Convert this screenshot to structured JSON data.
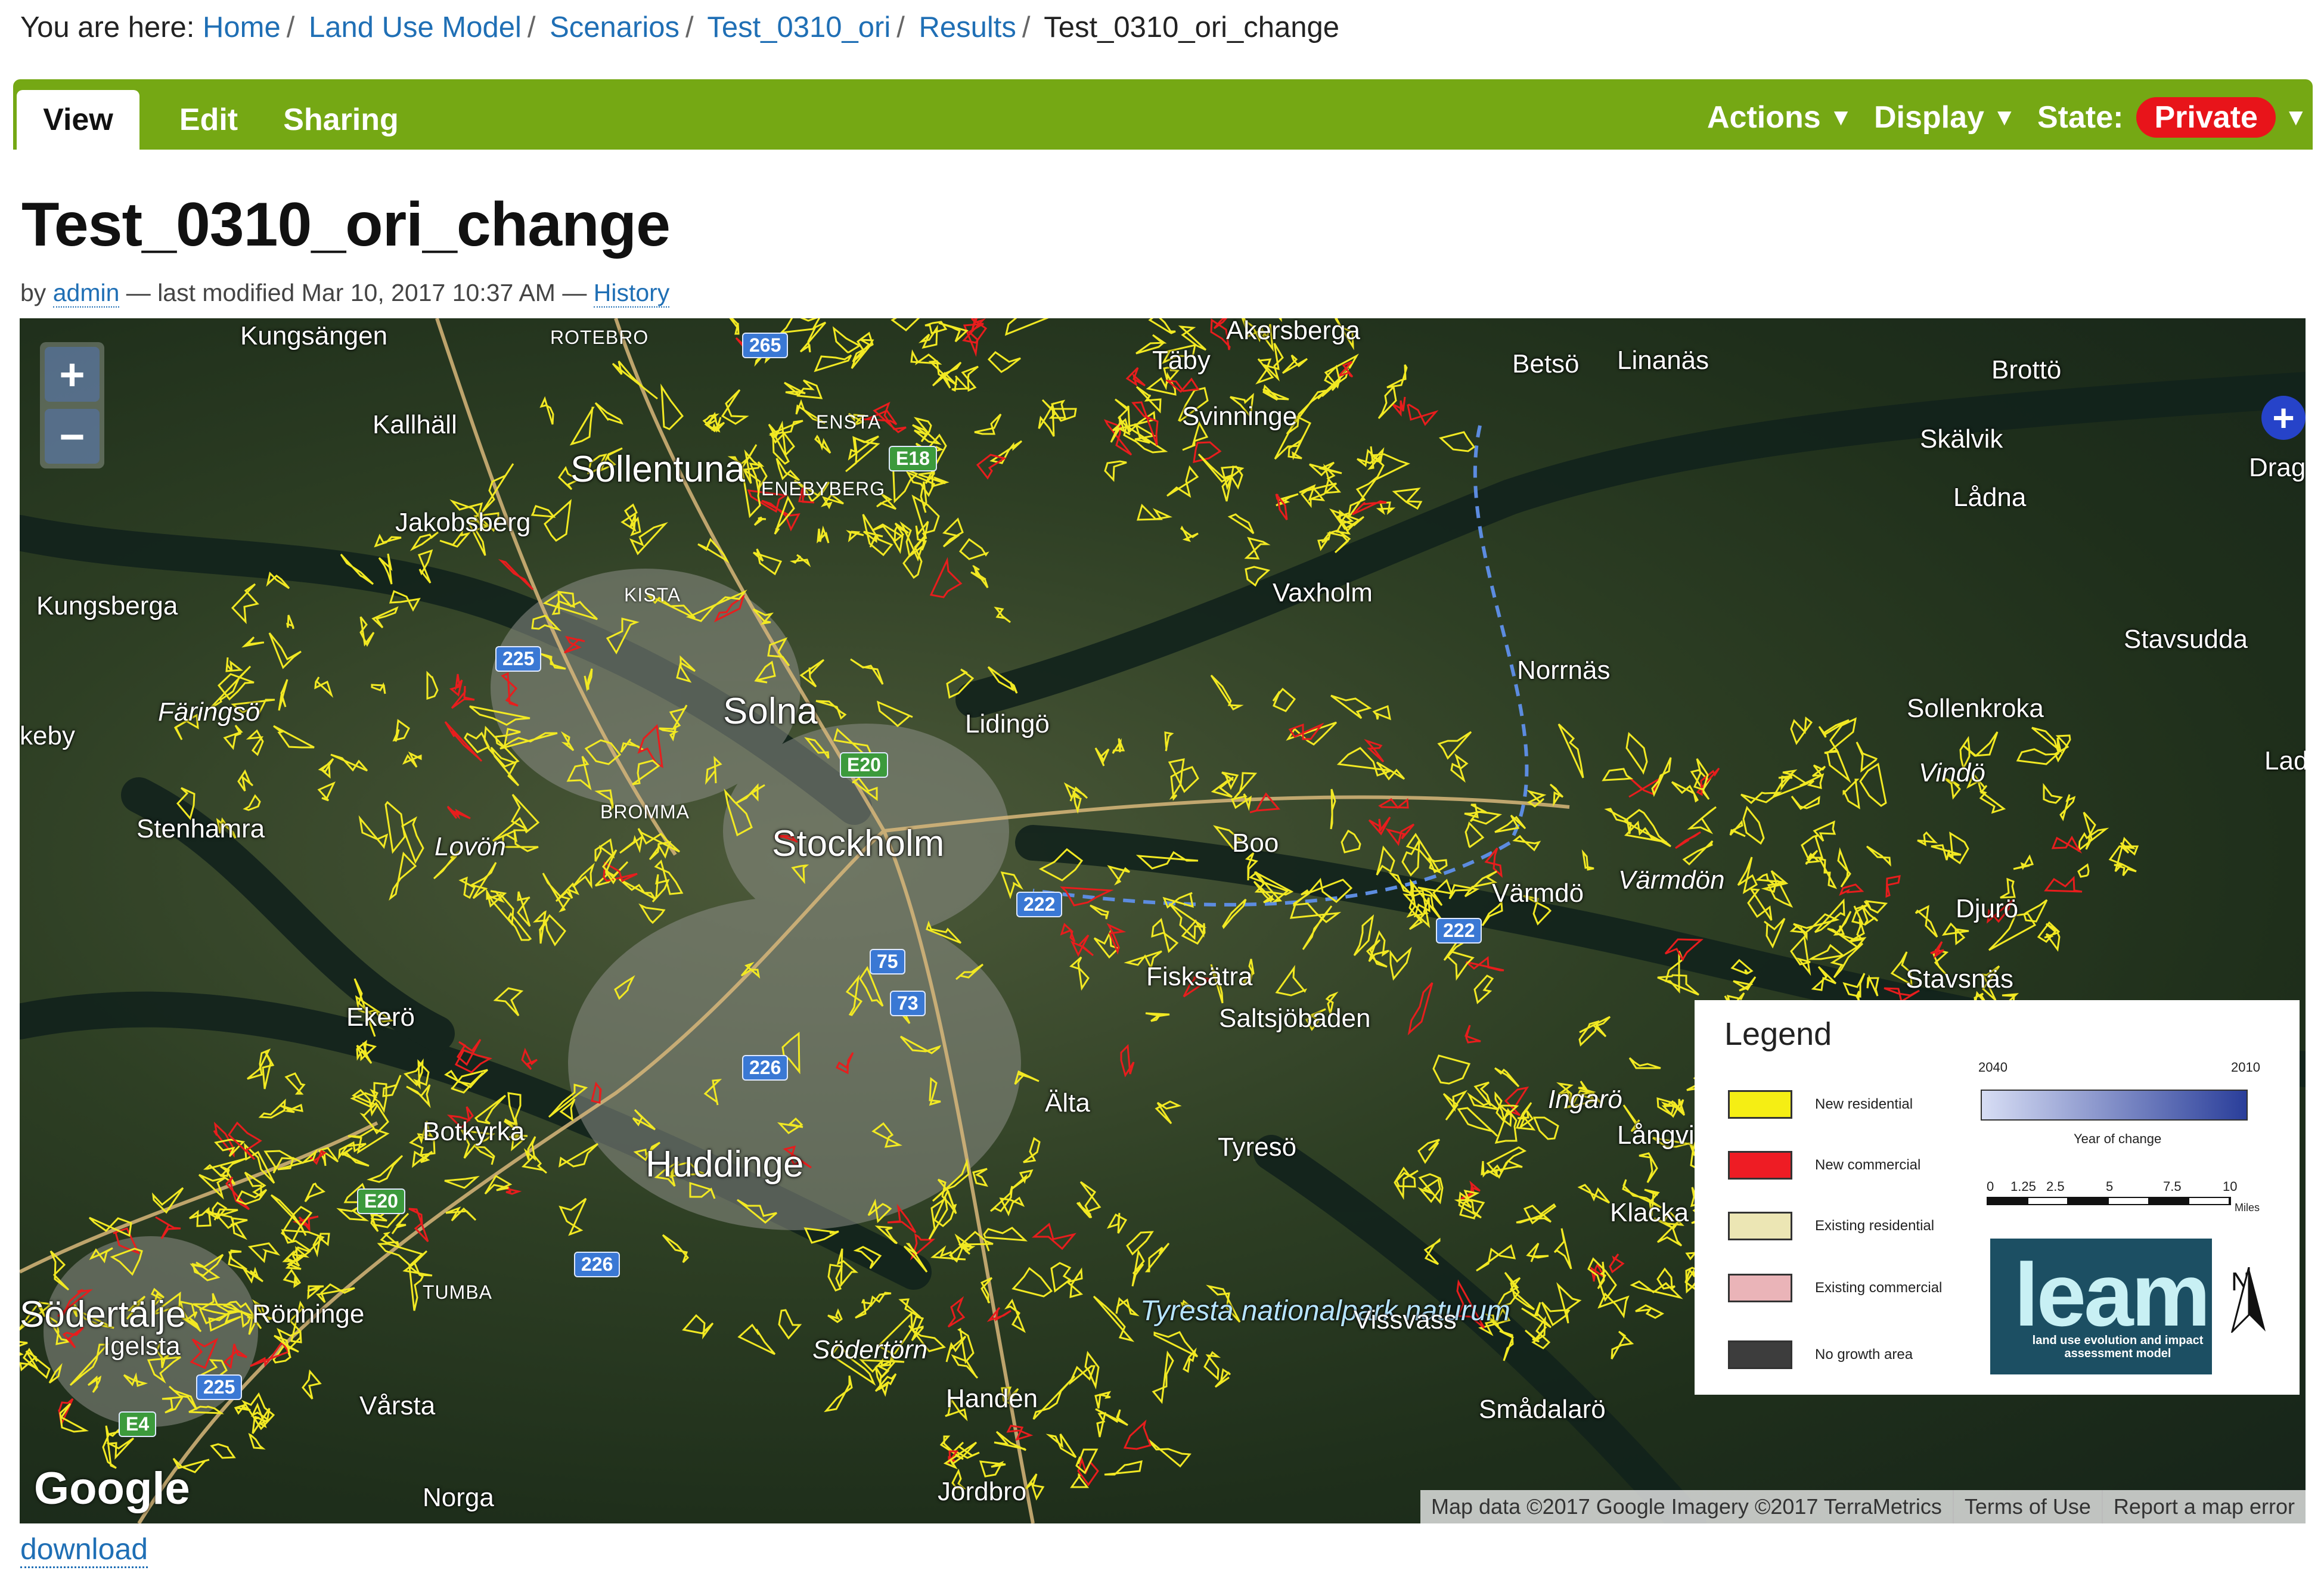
{
  "breadcrumb": {
    "prefix": "You are here:",
    "items": [
      "Home",
      "Land Use Model",
      "Scenarios",
      "Test_0310_ori",
      "Results"
    ],
    "current": "Test_0310_ori_change",
    "separator": "/"
  },
  "tabs": [
    "View",
    "Edit",
    "Sharing"
  ],
  "menus": {
    "actions": "Actions",
    "display": "Display",
    "state_label": "State:",
    "state_value": "Private",
    "caret": "▼",
    "state_color": "#e8141a"
  },
  "bar_color": "#75a814",
  "title": "Test_0310_ori_change",
  "byline": {
    "by": "by",
    "author": "admin",
    "modified": "— last modified Mar 10, 2017 10:37 AM —",
    "history": "History"
  },
  "map": {
    "zoom_in": "+",
    "zoom_out": "−",
    "expand": "+",
    "places": {
      "kungsangen": "Kungsängen",
      "rotebro": "ROTEBRO",
      "akersberga": "Akersberga",
      "taby": "Täby",
      "betso": "Betsö",
      "linanas": "Linanäs",
      "brotto": "Brottö",
      "kallhall": "Kallhäll",
      "ensta": "ENSTA",
      "svinninge": "Svinninge",
      "skalvik": "Skälvik",
      "drag": "Drag",
      "sollentuna": "Sollentuna",
      "enebyberg": "ENEBYBERG",
      "ladna": "Lådna",
      "jakobsberg": "Jakobsberg",
      "kista": "KISTA",
      "kungsberga": "Kungsberga",
      "vaxholm": "Vaxholm",
      "stavsudda": "Stavsudda",
      "norrnas": "Norrnäs",
      "faringso": "Färingsö",
      "solna": "Solna",
      "lidingo": "Lidingö",
      "sollenkroka": "Sollenkroka",
      "keby": "keby",
      "vindo": "Vindö",
      "lad": "Lad",
      "stenhamra": "Stenhamra",
      "bromma": "BROMMA",
      "lovon": "Lovön",
      "stockholm": "Stockholm",
      "boo": "Boo",
      "varmdon": "Värmdön",
      "varmdo": "Värmdö",
      "djuro": "Djurö",
      "fisksatra": "Fisksätra",
      "stavsnas": "Stavsnäs",
      "ekero": "Ekerö",
      "saltsjobaden": "Saltsjöbaden",
      "ingaro": "Ingarö",
      "alta": "Älta",
      "langvik": "Långvi",
      "botkyrka": "Botkyrka",
      "tyreso": "Tyresö",
      "huddinge": "Huddinge",
      "klacka": "Klacka",
      "sodertalje": "Södertälje",
      "ronninge": "Rönninge",
      "tumba": "TUMBA",
      "tyresta": "Tyresta nationalpark naturum",
      "vissvass": "Vissvass",
      "igelsta": "Igelsta",
      "sodertorn": "Södertörn",
      "handen": "Handen",
      "varsta": "Vårsta",
      "smadalaro": "Smådalarö",
      "norga": "Norga",
      "jordbro": "Jordbro"
    },
    "roads": [
      "265",
      "E18",
      "225",
      "E20",
      "222",
      "75",
      "73",
      "226",
      "222",
      "E20",
      "226",
      "225",
      "E4"
    ],
    "google": "Google",
    "attribution": [
      "Map data ©2017 Google Imagery ©2017 TerraMetrics",
      "Terms of Use",
      "Report a map error"
    ],
    "colors": {
      "residential": "#f2e923",
      "commercial": "#e81d1d"
    }
  },
  "legend": {
    "title": "Legend",
    "items": [
      {
        "label": "New residential",
        "color": "#f5ee14"
      },
      {
        "label": "New commercial",
        "color": "#ee1c24"
      },
      {
        "label": "Existing residential",
        "color": "#ece6b4"
      },
      {
        "label": "Existing commercial",
        "color": "#eab4b8"
      },
      {
        "label": "No growth area",
        "color": "#3d3d3d"
      }
    ],
    "ramp_start": "2040",
    "ramp_end": "2010",
    "ramp_caption": "Year of change",
    "scale_ticks": [
      "0",
      "1.25",
      "2.5",
      "5",
      "7.5",
      "10"
    ],
    "scale_unit": "Miles",
    "logo_word": "leam",
    "logo_sub": "land use evolution and impact assessment model",
    "north": "N"
  },
  "download": "download"
}
